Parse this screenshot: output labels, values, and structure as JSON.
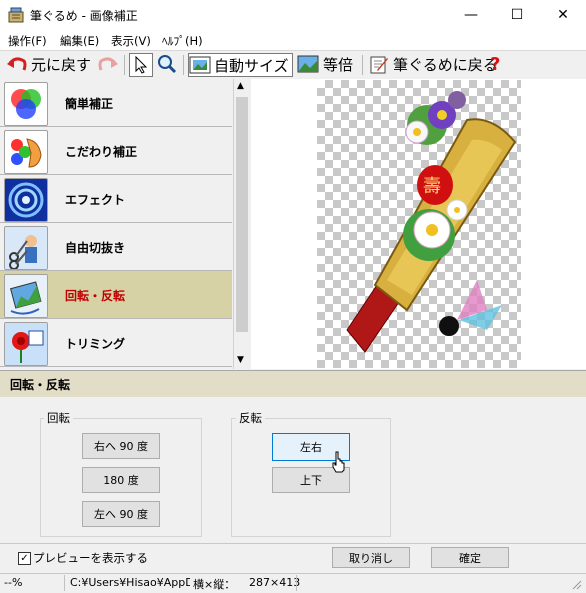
{
  "window": {
    "title": "筆ぐるめ - 画像補正",
    "minimize_glyph": "—",
    "maximize_glyph": "☐",
    "close_glyph": "✕"
  },
  "menu": {
    "items": [
      "操作(F)",
      "編集(E)",
      "表示(V)",
      "ﾍﾙﾌﾟ(H)"
    ]
  },
  "toolbar": {
    "undo_label": "元に戻す",
    "auto_size_label": "自動サイズ",
    "actual_size_label": "等倍",
    "back_label": "筆ぐるめに戻る",
    "help_glyph": "?"
  },
  "sidebar": {
    "items": [
      {
        "label": "簡単補正"
      },
      {
        "label": "こだわり補正"
      },
      {
        "label": "エフェクト"
      },
      {
        "label": "自由切抜き"
      },
      {
        "label": "回転・反転",
        "selected": true
      },
      {
        "label": "トリミング"
      }
    ]
  },
  "section": {
    "title": "回転・反転"
  },
  "rotate_group": {
    "label": "回転",
    "buttons": [
      "右へ 90 度",
      "180 度",
      "左へ 90 度"
    ]
  },
  "flip_group": {
    "label": "反転",
    "buttons": [
      "左右",
      "上下"
    ]
  },
  "footer": {
    "preview_checkbox_label": "プレビューを表示する",
    "preview_checked": true,
    "cancel_label": "取り消し",
    "ok_label": "確定"
  },
  "status": {
    "zoom": "--%",
    "path": "C:¥Users¥Hisao¥AppDa",
    "size_label": "横×縦：",
    "size_value": "287×413"
  },
  "colors": {
    "selected_item_bg": "#d6d2a6",
    "selected_item_text": "#c00000",
    "section_bar_bg": "#e1ddc6",
    "focus_border": "#0078d7"
  }
}
